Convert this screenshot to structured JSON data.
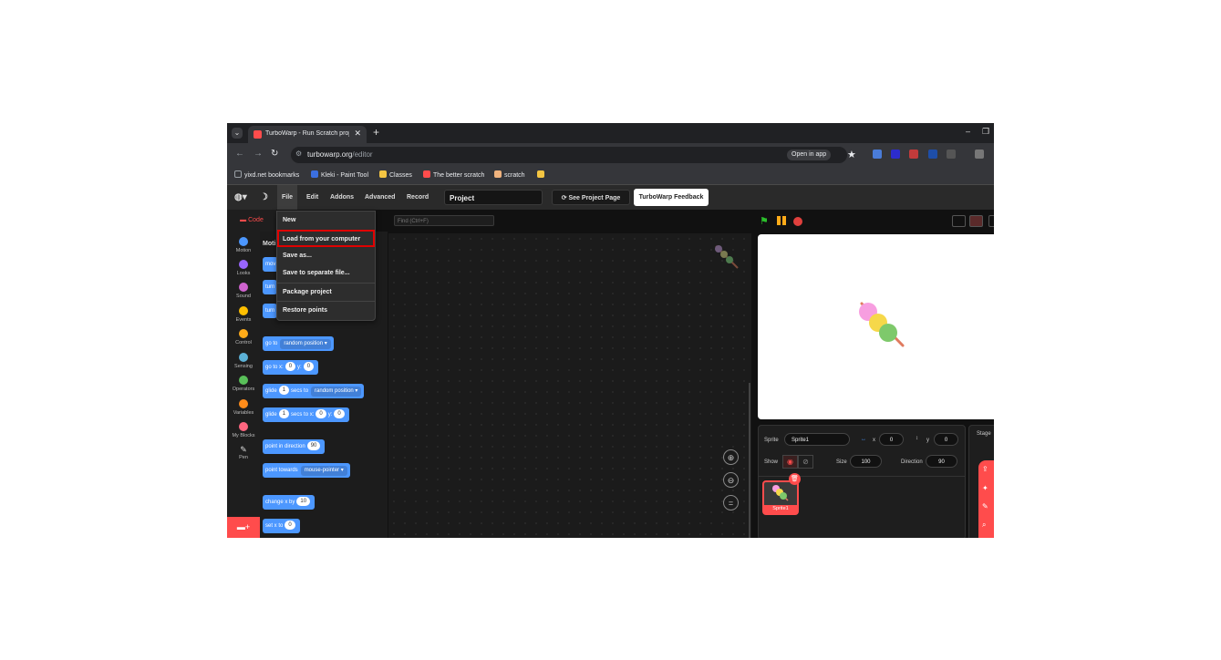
{
  "browser": {
    "tab_title": "TurboWarp - Run Scratch projects",
    "address": {
      "domain": "turbowarp.org",
      "path": "/editor"
    },
    "open_in_app": "Open in app",
    "bookmarks": [
      {
        "label": "yixd.net bookmarks",
        "color": "#9aa0a6"
      },
      {
        "label": "Kleki - Paint Tool",
        "color": "#3b6fe0"
      },
      {
        "label": "Classes",
        "color": "#f4c542"
      },
      {
        "label": "The better scratch",
        "color": "#ff4c4c"
      },
      {
        "label": "scratch",
        "color": "#f0b37e"
      },
      {
        "label": "",
        "color": "#f4c542"
      }
    ]
  },
  "editor": {
    "menus": [
      "File",
      "Edit",
      "Addons",
      "Advanced",
      "Record"
    ],
    "project_title": "Project",
    "see_project_page": "See Project Page",
    "feedback": "TurboWarp Feedback",
    "code_tab": "Code",
    "find_placeholder": "Find (Ctrl+F)",
    "palette_title": "Moti",
    "categories": [
      {
        "label": "Motion",
        "color": "#4c97ff"
      },
      {
        "label": "Looks",
        "color": "#9966ff"
      },
      {
        "label": "Sound",
        "color": "#cf63cf"
      },
      {
        "label": "Events",
        "color": "#ffbf00"
      },
      {
        "label": "Control",
        "color": "#ffab19"
      },
      {
        "label": "Sensing",
        "color": "#5cb1d6"
      },
      {
        "label": "Operators",
        "color": "#59c059"
      },
      {
        "label": "Variables",
        "color": "#ff8c1a"
      },
      {
        "label": "My Blocks",
        "color": "#ff6680"
      },
      {
        "label": "Pen",
        "color": "#0fbd8c"
      }
    ],
    "blocks": {
      "partial1": "mov",
      "partial2": "turn",
      "partial3": "turn",
      "goto_label": "go to",
      "goto_dd": "random position",
      "gotoxy_label": "go to x:",
      "gotoxy_x": "0",
      "gotoxy_y_label": "y:",
      "gotoxy_y": "0",
      "glide_label": "glide",
      "glide_secs": "1",
      "glide_to": "secs to",
      "glide_dd": "random position",
      "glide2_label": "glide",
      "glide2_secs": "1",
      "glide2_to": "secs to x:",
      "glide2_x": "0",
      "glide2_y_label": "y:",
      "glide2_y": "0",
      "point_dir_label": "point in direction",
      "point_dir_val": "90",
      "point_towards_label": "point towards",
      "point_towards_dd": "mouse-pointer",
      "changex_label": "change x by",
      "changex_val": "10",
      "setx_label": "set x to",
      "setx_val": "0"
    },
    "file_menu": [
      "New",
      "Load from your computer",
      "Save as...",
      "Save to separate file...",
      "Package project",
      "Restore points"
    ],
    "sprite_info": {
      "sprite_label": "Sprite",
      "sprite_name": "Sprite1",
      "x_label": "x",
      "x": "0",
      "y_label": "y",
      "y": "0",
      "show_label": "Show",
      "size_label": "Size",
      "size": "100",
      "direction_label": "Direction",
      "direction": "90"
    },
    "sprite_thumb_label": "Sprite1",
    "stage_label": "Stage"
  }
}
